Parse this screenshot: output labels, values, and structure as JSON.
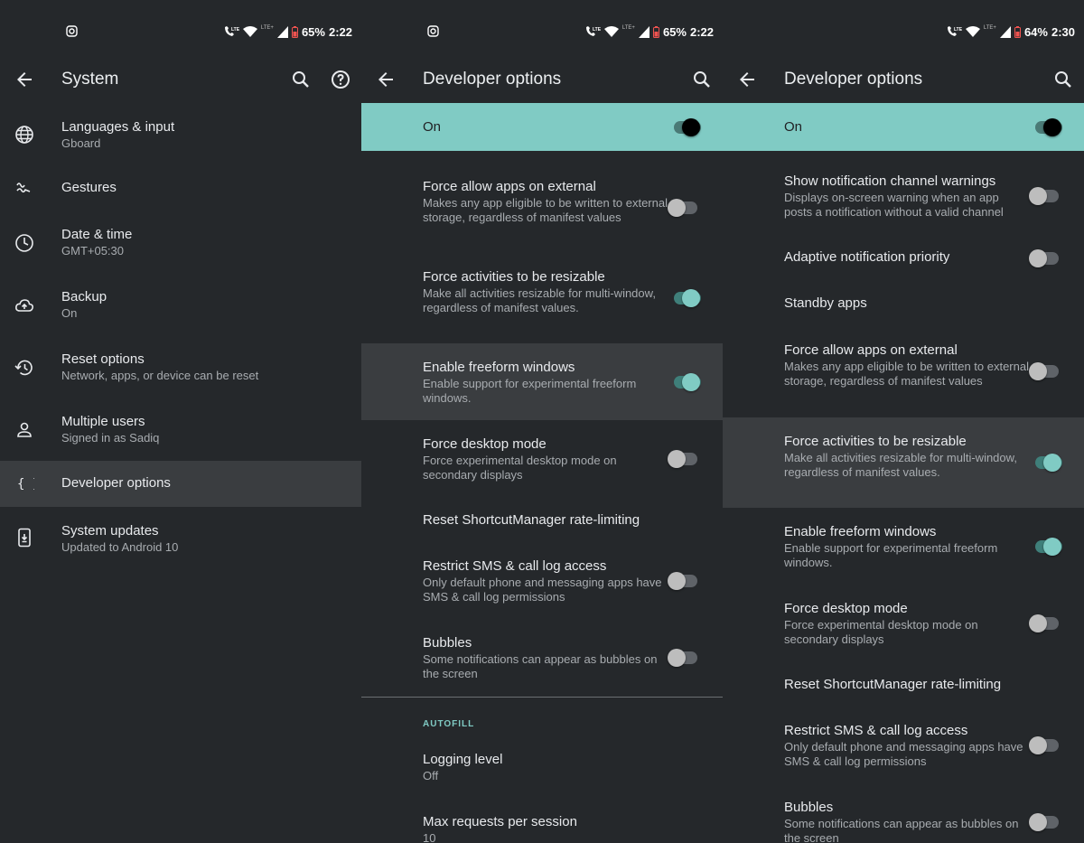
{
  "screens": [
    {
      "status": {
        "battery": "65%",
        "time": "2:22"
      },
      "title": "System",
      "items": [
        {
          "title": "Languages & input",
          "subtitle": "Gboard",
          "icon": "globe-icon"
        },
        {
          "title": "Gestures",
          "subtitle": "",
          "icon": "gestures-icon"
        },
        {
          "title": "Date & time",
          "subtitle": "GMT+05:30",
          "icon": "clock-icon"
        },
        {
          "title": "Backup",
          "subtitle": "On",
          "icon": "cloud-upload-icon"
        },
        {
          "title": "Reset options",
          "subtitle": "Network, apps, or device can be reset",
          "icon": "history-icon"
        },
        {
          "title": "Multiple users",
          "subtitle": "Signed in as Sadiq",
          "icon": "person-icon"
        },
        {
          "title": "Developer options",
          "subtitle": "",
          "icon": "braces-icon"
        },
        {
          "title": "System updates",
          "subtitle": "Updated to Android 10",
          "icon": "system-update-icon"
        }
      ]
    },
    {
      "status": {
        "battery": "65%",
        "time": "2:22"
      },
      "title": "Developer options",
      "on_label": "On",
      "items": [
        {
          "title": "Force allow apps on external",
          "subtitle": "Makes any app eligible to be written to external storage, regardless of manifest values",
          "toggle": "off"
        },
        {
          "title": "Force activities to be resizable",
          "subtitle": "Make all activities resizable for multi-window, regardless of manifest values.",
          "toggle": "on"
        },
        {
          "title": "Enable freeform windows",
          "subtitle": "Enable support for experimental freeform windows.",
          "toggle": "on"
        },
        {
          "title": "Force desktop mode",
          "subtitle": "Force experimental desktop mode on secondary displays",
          "toggle": "off"
        },
        {
          "title": "Reset ShortcutManager rate-limiting",
          "subtitle": ""
        },
        {
          "title": "Restrict SMS & call log access",
          "subtitle": "Only default phone and messaging apps have SMS & call log permissions",
          "toggle": "off"
        },
        {
          "title": "Bubbles",
          "subtitle": "Some notifications can appear as bubbles on the screen",
          "toggle": "off"
        }
      ],
      "section_label": "AUTOFILL",
      "after_items": [
        {
          "title": "Logging level",
          "subtitle": "Off"
        },
        {
          "title": "Max requests per session",
          "subtitle": "10"
        }
      ]
    },
    {
      "status": {
        "battery": "64%",
        "time": "2:30"
      },
      "title": "Developer options",
      "on_label": "On",
      "items": [
        {
          "title": "Show notification channel warnings",
          "subtitle": "Displays on-screen warning when an app posts a notification without a valid channel",
          "toggle": "off"
        },
        {
          "title": "Adaptive notification priority",
          "subtitle": "",
          "toggle": "off"
        },
        {
          "title": "Standby apps",
          "subtitle": ""
        },
        {
          "title": "Force allow apps on external",
          "subtitle": "Makes any app eligible to be written to external storage, regardless of manifest values",
          "toggle": "off"
        },
        {
          "title": "Force activities to be resizable",
          "subtitle": "Make all activities resizable for multi-window, regardless of manifest values.",
          "toggle": "on"
        },
        {
          "title": "Enable freeform windows",
          "subtitle": "Enable support for experimental freeform windows.",
          "toggle": "on"
        },
        {
          "title": "Force desktop mode",
          "subtitle": "Force experimental desktop mode on secondary displays",
          "toggle": "off"
        },
        {
          "title": "Reset ShortcutManager rate-limiting",
          "subtitle": ""
        },
        {
          "title": "Restrict SMS & call log access",
          "subtitle": "Only default phone and messaging apps have SMS & call log permissions",
          "toggle": "off"
        },
        {
          "title": "Bubbles",
          "subtitle": "Some notifications can appear as bubbles on the screen",
          "toggle": "off"
        }
      ]
    }
  ],
  "colors": {
    "background": "#25282b",
    "accent": "#80cbc4",
    "highlight": "#3a3d40"
  }
}
